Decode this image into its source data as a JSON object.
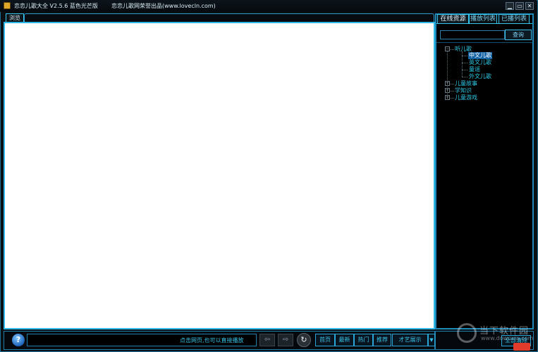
{
  "window": {
    "title": "恋恋儿歌大全  V2.5.6 蓝色光芒版",
    "credit": "恋恋儿歌网荣誉出品(www.lovecln.com)",
    "min_label": "▁",
    "max_label": "▭",
    "close_label": "✕"
  },
  "browse": {
    "tab_label": "浏览"
  },
  "right_panel": {
    "tabs": [
      {
        "label": "在线资源"
      },
      {
        "label": "播放列表"
      },
      {
        "label": "已播列表"
      }
    ],
    "search": {
      "value": "",
      "button_label": "查询"
    },
    "tree": {
      "expanders": {
        "expanded": "−",
        "collapsed": "+"
      },
      "items": [
        {
          "label": "听儿歌"
        },
        {
          "label": "中文儿歌"
        },
        {
          "label": "英文儿歌"
        },
        {
          "label": "童谣"
        },
        {
          "label": "外文儿歌"
        },
        {
          "label": "儿童故事"
        },
        {
          "label": "学知识"
        },
        {
          "label": "儿童游戏"
        }
      ]
    }
  },
  "bottom": {
    "help_label": "?",
    "status_text": "点击网页,也可以直接播放",
    "back_label": "⇦",
    "forward_label": "⇨",
    "refresh_label": "↻",
    "categories": [
      {
        "label": "首页"
      },
      {
        "label": "最新"
      },
      {
        "label": "热门"
      },
      {
        "label": "推荐"
      },
      {
        "label": "才艺展示"
      }
    ],
    "dropdown_label": "▼",
    "right_button_label": "全部清除"
  },
  "watermark": {
    "text": "当下软件园",
    "url": "www.downxia.com"
  },
  "colors": {
    "accent": "#2cb7e8",
    "background": "#0a0f14",
    "tree_text": "#2ec8e6",
    "selection": "#1463a4"
  }
}
